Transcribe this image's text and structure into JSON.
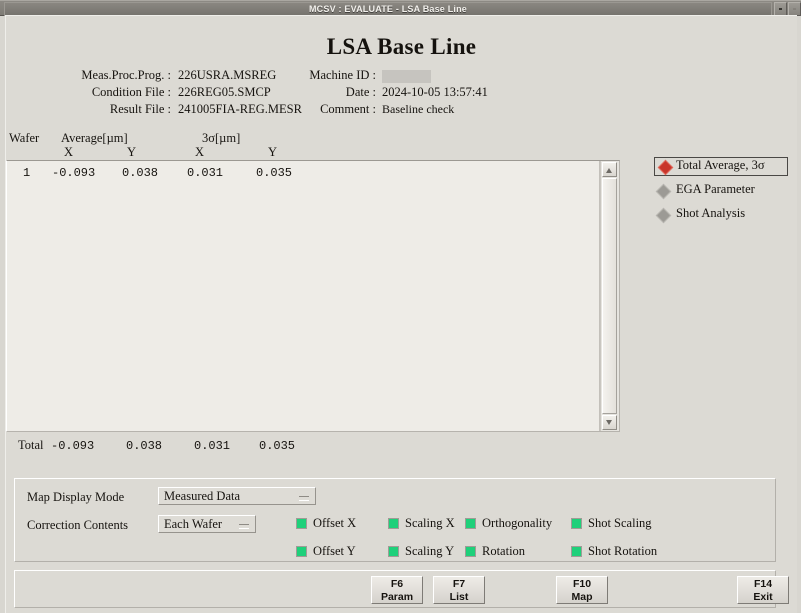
{
  "window": {
    "title": "MCSV : EVALUATE - LSA Base Line",
    "controls": [
      "minimize-button",
      "maximize-button"
    ]
  },
  "page_title": "LSA Base Line",
  "header": {
    "left_fields": [
      {
        "label": "Meas.Proc.Prog. :",
        "value": "226USRA.MSREG"
      },
      {
        "label": "Condition File :",
        "value": "226REG05.SMCP"
      },
      {
        "label": "Result File :",
        "value": "241005FIA-REG.MESR"
      }
    ],
    "right_fields": [
      {
        "label": "Machine ID :",
        "value": "",
        "redacted": true
      },
      {
        "label": "Date :",
        "value": "2024-10-05 13:57:41",
        "redacted": false
      },
      {
        "label": "Comment :",
        "value": "Baseline check",
        "redacted": false
      }
    ]
  },
  "table": {
    "columns": {
      "wafer": "Wafer",
      "average_group": "Average[µm]",
      "sigma_group": "3σ[µm]",
      "avg_x": "X",
      "avg_y": "Y",
      "sig_x": "X",
      "sig_y": "Y"
    },
    "rows": [
      {
        "wafer": "1",
        "avg_x": "-0.093",
        "avg_y": "0.038",
        "sig_x": "0.031",
        "sig_y": "0.035"
      }
    ],
    "total": {
      "label": "Total",
      "avg_x": "-0.093",
      "avg_y": "0.038",
      "sig_x": "0.031",
      "sig_y": "0.035"
    },
    "scrollbar": {
      "up_arrow": "scroll-up",
      "down_arrow": "scroll-down"
    }
  },
  "analysis_modes": {
    "selected_index": 0,
    "items": [
      {
        "label": "Total Average, 3σ",
        "selected": true
      },
      {
        "label": "EGA Parameter",
        "selected": false
      },
      {
        "label": "Shot Analysis",
        "selected": false
      }
    ],
    "selected_color": "#c8352a",
    "unselected_color": "#9c9a95"
  },
  "options": {
    "map_display_mode": {
      "label": "Map Display Mode",
      "value": "Measured Data"
    },
    "correction_contents": {
      "label": "Correction Contents",
      "value": "Each Wafer"
    },
    "checkbox_color": "#1fd07a",
    "checkboxes": [
      {
        "label": "Offset X",
        "checked": true
      },
      {
        "label": "Scaling X",
        "checked": true
      },
      {
        "label": "Orthogonality",
        "checked": true
      },
      {
        "label": "Shot Scaling",
        "checked": true
      },
      {
        "label": "Offset Y",
        "checked": true
      },
      {
        "label": "Scaling Y",
        "checked": true
      },
      {
        "label": "Rotation",
        "checked": true
      },
      {
        "label": "Shot Rotation",
        "checked": true
      }
    ]
  },
  "function_keys": [
    {
      "key": "F6",
      "name": "Param"
    },
    {
      "key": "F7",
      "name": "List"
    },
    {
      "key": "F10",
      "name": "Map"
    },
    {
      "key": "F14",
      "name": "Exit"
    }
  ]
}
